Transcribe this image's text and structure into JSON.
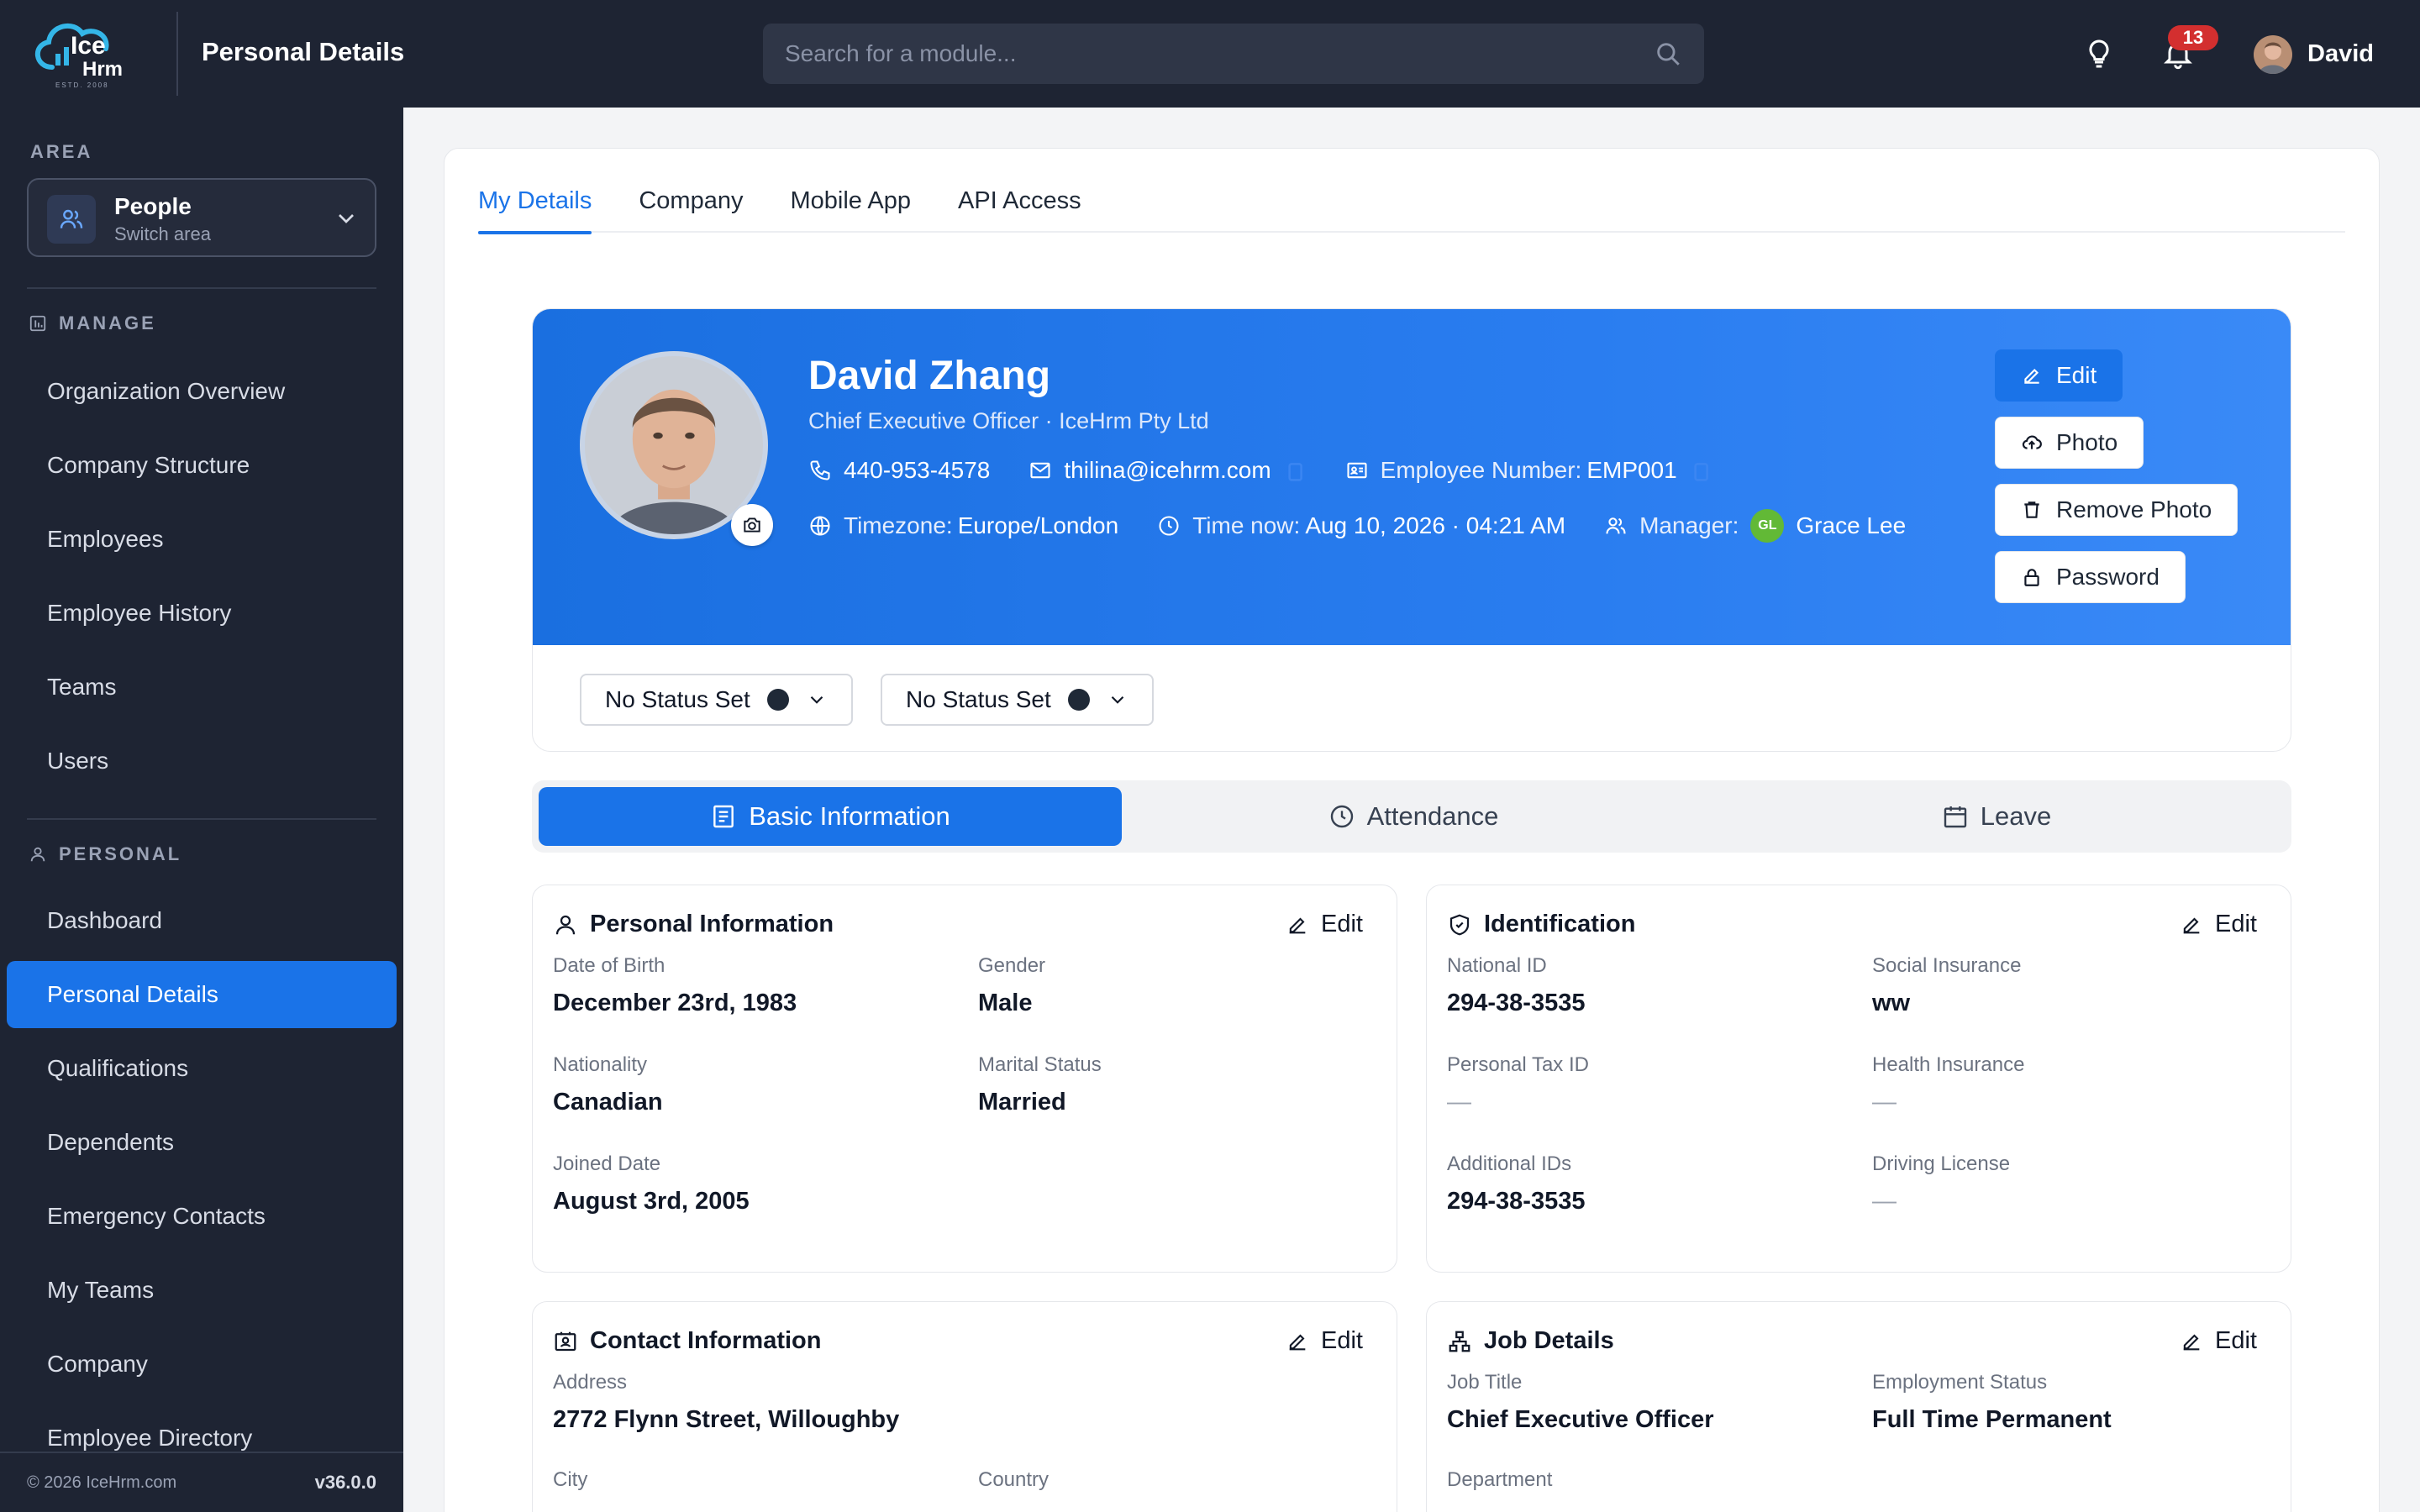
{
  "app": {
    "page_title": "Personal Details",
    "logo_text": "Ice",
    "logo_text2": "Hrm",
    "logo_tag": "ESTD. 2008"
  },
  "header": {
    "search_placeholder": "Search for a module...",
    "notifications_count": "13",
    "user_name": "David"
  },
  "sidebar": {
    "area_label": "AREA",
    "area_title": "People",
    "area_sub": "Switch area",
    "manage_label": "MANAGE",
    "manage_items": [
      "Organization Overview",
      "Company Structure",
      "Employees",
      "Employee History",
      "Teams",
      "Users"
    ],
    "personal_label": "PERSONAL",
    "personal_items": [
      "Dashboard",
      "Personal Details",
      "Qualifications",
      "Dependents",
      "Emergency Contacts",
      "My Teams",
      "Company",
      "Employee Directory"
    ],
    "active_item": "Personal Details",
    "copyright": "© 2026 IceHrm.com",
    "version": "v36.0.0"
  },
  "tabs": [
    "My Details",
    "Company",
    "Mobile App",
    "API Access"
  ],
  "profile": {
    "name": "David Zhang",
    "role": "Chief Executive Officer · IceHrm Pty Ltd",
    "phone": "440-953-4578",
    "email": "thilina@icehrm.com",
    "employee_number_label": "Employee Number:",
    "employee_number": "EMP001",
    "timezone_label": "Timezone:",
    "timezone": "Europe/London",
    "time_label": "Time now:",
    "time": "Aug 10, 2026 · 04:21 AM",
    "manager_label": "Manager:",
    "manager_initials": "GL",
    "manager": "Grace Lee",
    "buttons": {
      "edit": "Edit",
      "photo": "Photo",
      "remove_photo": "Remove Photo",
      "password": "Password"
    },
    "status1": "No Status Set",
    "status2": "No Status Set"
  },
  "subtabs": [
    "Basic Information",
    "Attendance",
    "Leave"
  ],
  "cards": {
    "edit_label": "Edit",
    "personal": {
      "title": "Personal Information",
      "dob_label": "Date of Birth",
      "dob": "December 23rd, 1983",
      "gender_label": "Gender",
      "gender": "Male",
      "nationality_label": "Nationality",
      "nationality": "Canadian",
      "marital_label": "Marital Status",
      "marital": "Married",
      "joined_label": "Joined Date",
      "joined": "August 3rd, 2005"
    },
    "identification": {
      "title": "Identification",
      "national_label": "National ID",
      "national": "294-38-3535",
      "social_label": "Social Insurance",
      "social": "ww",
      "tax_label": "Personal Tax ID",
      "tax": "—",
      "health_label": "Health Insurance",
      "health": "—",
      "additional_label": "Additional IDs",
      "additional": "294-38-3535",
      "driving_label": "Driving License",
      "driving": "—"
    },
    "contact": {
      "title": "Contact Information",
      "address_label": "Address",
      "address": "2772 Flynn Street, Willoughby",
      "city_label": "City",
      "country_label": "Country"
    },
    "job": {
      "title": "Job Details",
      "jobtitle_label": "Job Title",
      "jobtitle": "Chief Executive Officer",
      "employment_label": "Employment Status",
      "employment": "Full Time Permanent",
      "department_label": "Department"
    }
  },
  "colors": {
    "accent": "#1a73e8",
    "sidebar_bg": "#1e2433",
    "badge": "#d32f2f"
  }
}
